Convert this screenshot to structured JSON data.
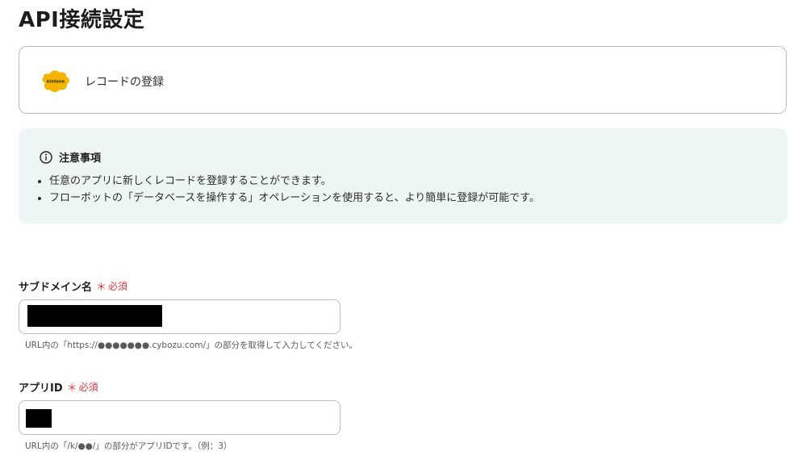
{
  "page": {
    "title": "API接続設定"
  },
  "app_card": {
    "logo_text": "kintone",
    "logo_color": "#f5b400",
    "label": "レコードの登録"
  },
  "notice": {
    "title": "注意事項",
    "background": "#eef6f5",
    "items": [
      "任意のアプリに新しくレコードを登録することができます。",
      "フローボットの「データベースを操作する」オペレーションを使用すると、より簡単に登録が可能です。"
    ]
  },
  "fields": {
    "subdomain": {
      "label": "サブドメイン名",
      "required_mark": "＊",
      "required_label": "必須",
      "value": "",
      "hint": "URL内の「https://●●●●●●●.cybozu.com/」の部分を取得して入力してください。"
    },
    "app_id": {
      "label": "アプリID",
      "required_mark": "＊",
      "required_label": "必須",
      "value": "",
      "hint": "URL内の「/k/●●/」の部分がアプリIDです。（例：3）"
    }
  },
  "colors": {
    "required": "#e0353b",
    "border": "#bdbdbd"
  }
}
